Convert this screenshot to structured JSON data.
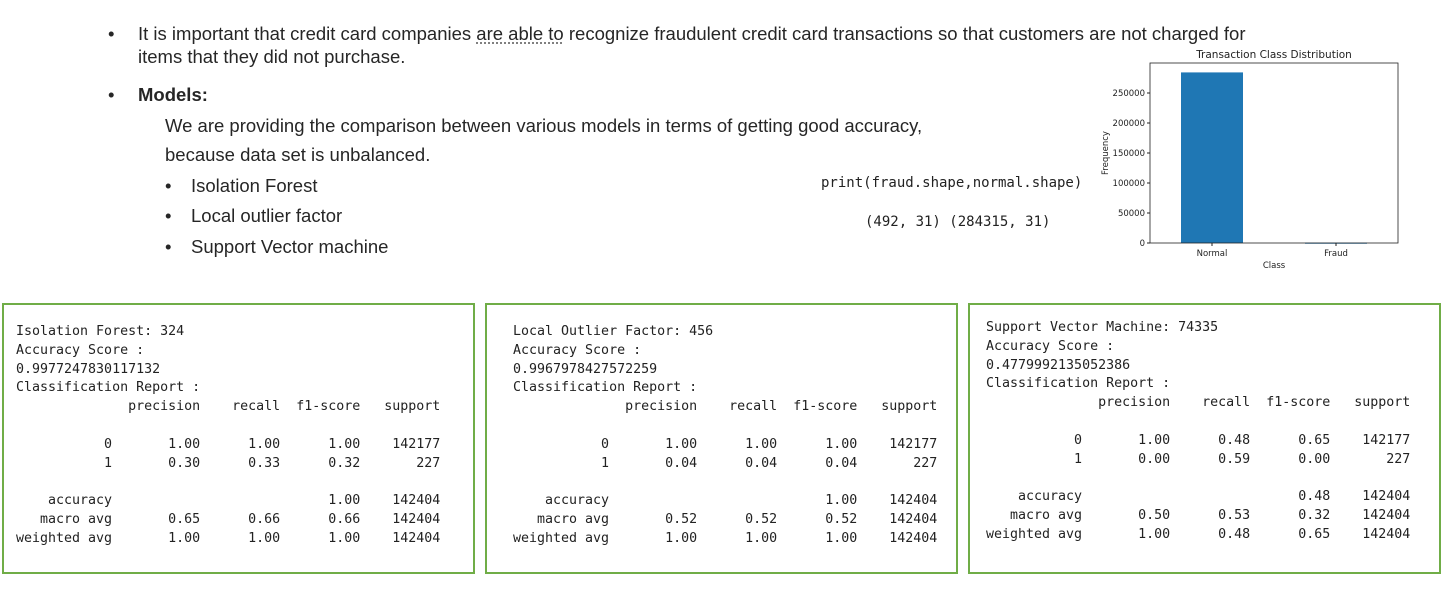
{
  "intro": {
    "part1": "It is important that credit card companies ",
    "underlined": "are able to",
    "part2": " recognize fraudulent credit card transactions so that customers are not charged for",
    "line2": "items that they did not purchase."
  },
  "models_heading": "Models:",
  "models_desc_line1": "We are providing the comparison between various models in terms of getting good accuracy,",
  "models_desc_line2": "because data set is unbalanced.",
  "models_list": [
    "Isolation Forest",
    "Local outlier factor",
    "Support Vector machine"
  ],
  "bullet_glyph": "•",
  "code": {
    "statement": "print(fraud.shape,normal.shape)",
    "output": "(492, 31) (284315, 31)"
  },
  "reports": [
    {
      "lines": [
        "Isolation Forest: 324",
        "Accuracy Score :",
        "0.9977247830117132",
        "Classification Report :",
        "              precision    recall  f1-score   support",
        "",
        "           0       1.00      1.00      1.00    142177",
        "           1       0.30      0.33      0.32       227",
        "",
        "    accuracy                           1.00    142404",
        "   macro avg       0.65      0.66      0.66    142404",
        "weighted avg       1.00      1.00      1.00    142404"
      ]
    },
    {
      "lines": [
        "Local Outlier Factor: 456",
        "Accuracy Score :",
        "0.9967978427572259",
        "Classification Report :",
        "              precision    recall  f1-score   support",
        "",
        "           0       1.00      1.00      1.00    142177",
        "           1       0.04      0.04      0.04       227",
        "",
        "    accuracy                           1.00    142404",
        "   macro avg       0.52      0.52      0.52    142404",
        "weighted avg       1.00      1.00      1.00    142404"
      ]
    },
    {
      "lines": [
        "Support Vector Machine: 74335",
        "Accuracy Score :",
        "0.4779992135052386",
        "Classification Report :",
        "              precision    recall  f1-score   support",
        "",
        "           0       1.00      0.48      0.65    142177",
        "           1       0.00      0.59      0.00       227",
        "",
        "    accuracy                           0.48    142404",
        "   macro avg       0.50      0.53      0.32    142404",
        "weighted avg       1.00      0.48      0.65    142404"
      ]
    }
  ],
  "chart_data": {
    "type": "bar",
    "title": "Transaction Class Distribution",
    "xlabel": "Class",
    "ylabel": "Frequency",
    "categories": [
      "Normal",
      "Fraud"
    ],
    "values": [
      284315,
      492
    ],
    "ylim": [
      0,
      300000
    ],
    "yticks": [
      0,
      50000,
      100000,
      150000,
      200000,
      250000
    ],
    "bar_color": "#1f77b4",
    "grid": false
  },
  "colors": {
    "panel_border": "#70ad47"
  }
}
